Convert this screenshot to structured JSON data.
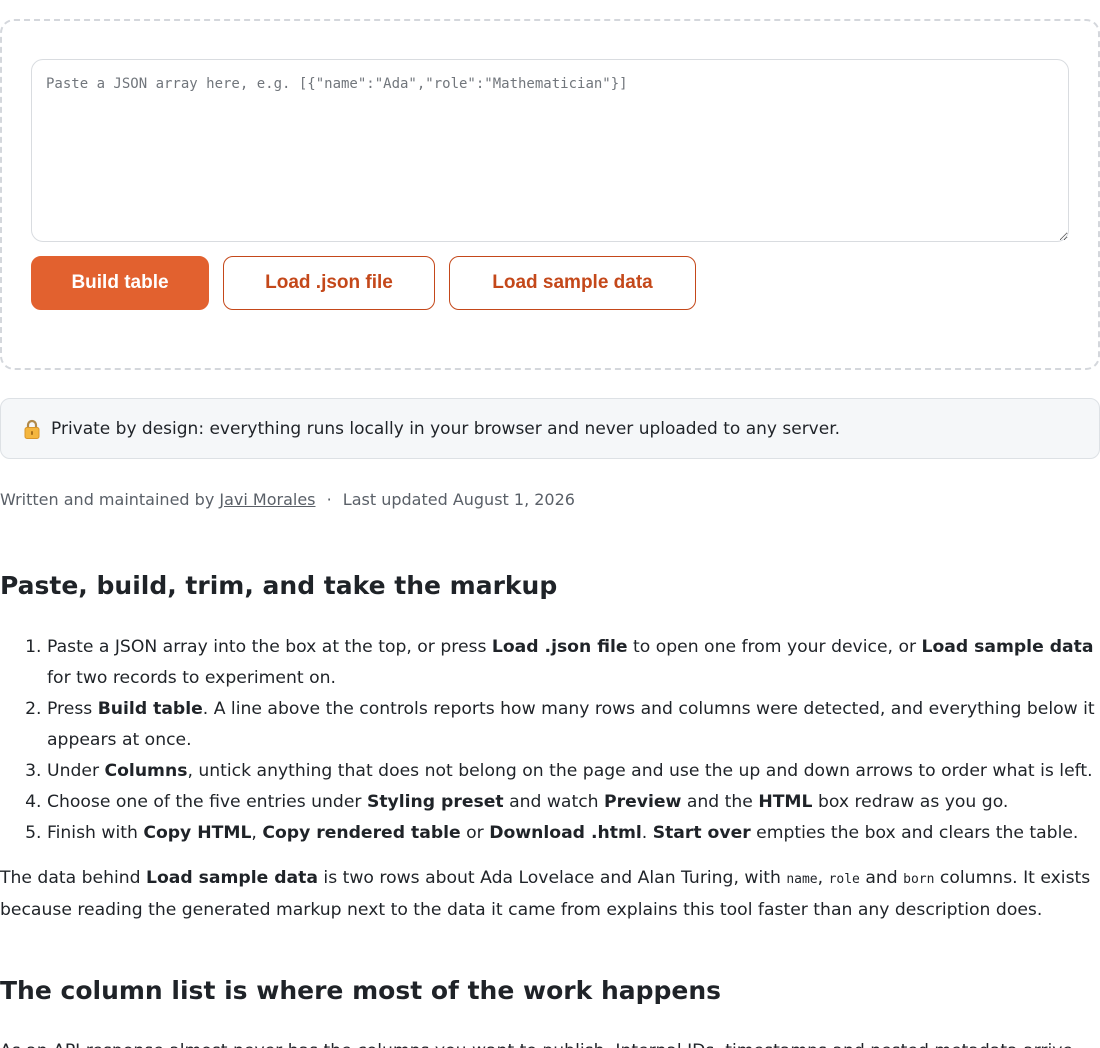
{
  "input": {
    "placeholder": "Paste a JSON array here, e.g. [{\"name\":\"Ada\",\"role\":\"Mathematician\"}]",
    "value": ""
  },
  "buttons": {
    "build": "Build table",
    "load_file": "Load .json file",
    "load_sample": "Load sample data"
  },
  "privacy": {
    "icon": "lock-icon",
    "text": "Private by design: everything runs locally in your browser and never uploaded to any server."
  },
  "byline": {
    "prefix": "Written and maintained by",
    "author": "Javi Morales",
    "separator": "·",
    "updated": "Last updated August 1, 2026"
  },
  "section1": {
    "heading": "Paste, build, trim, and take the markup",
    "steps": [
      {
        "a": "Paste a JSON array into the box at the top, or press ",
        "b1": "Load .json file",
        "c": " to open one from your device, or ",
        "b2": "Load sample data",
        "d": " for two records to experiment on."
      },
      {
        "a": "Press ",
        "b1": "Build table",
        "c": ". A line above the controls reports how many rows and columns were detected, and everything below it appears at once."
      },
      {
        "a": "Under ",
        "b1": "Columns",
        "c": ", untick anything that does not belong on the page and use the up and down arrows to order what is left."
      },
      {
        "a": "Choose one of the five entries under ",
        "b1": "Styling preset",
        "c": " and watch ",
        "b2": "Preview",
        "d": " and the ",
        "b3": "HTML",
        "e": " box redraw as you go."
      },
      {
        "a": "Finish with ",
        "b1": "Copy HTML",
        "c": ", ",
        "b2": "Copy rendered table",
        "d": " or ",
        "b3": "Download .html",
        "e": ". ",
        "b4": "Start over",
        "f": " empties the box and clears the table."
      }
    ],
    "paragraph": {
      "a": "The data behind ",
      "b1": "Load sample data",
      "c": " is two rows about Ada Lovelace and Alan Turing, with ",
      "code1": "name",
      "d": ", ",
      "code2": "role",
      "e": " and ",
      "code3": "born",
      "f": " columns. It exists because reading the generated markup next to the data it came from explains this tool faster than any description does."
    }
  },
  "section2": {
    "heading": "The column list is where most of the work happens",
    "paragraph_partial": "As an API response almost never has the columns you want to publish, Internal IDs, timestamps and nested metadata arrive"
  },
  "colors": {
    "accent": "#e2612f",
    "accent_text": "#c4481a",
    "notice_bg": "#f5f7f9"
  }
}
